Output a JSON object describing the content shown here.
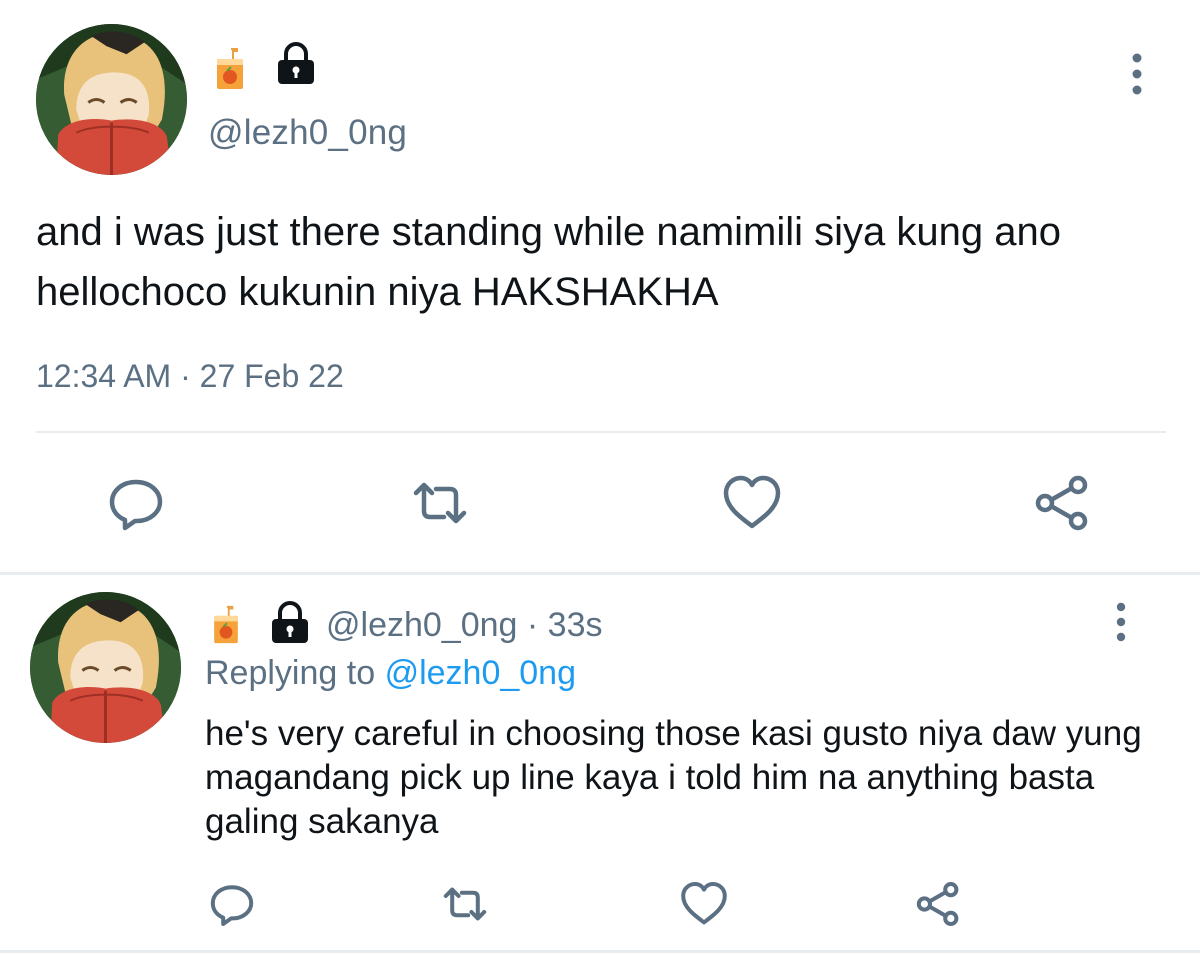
{
  "main_tweet": {
    "handle": "@lezh0_0ng",
    "text": "and i was just there standing while namimili siya kung ano hellochoco kukunin niya HAKSHAKHA",
    "time": "12:34 AM",
    "separator": "·",
    "date": "27 Feb 22",
    "name_icons": [
      "juice-box-icon",
      "lock-icon"
    ]
  },
  "reply_tweet": {
    "handle": "@lezh0_0ng",
    "separator": "·",
    "time_ago": "33s",
    "replying_prefix": "Replying to",
    "replying_to": "@lezh0_0ng",
    "text": "he's very careful in choosing those kasi gusto niya daw yung magandang pick up line kaya i told him na anything basta galing sakanya",
    "name_icons": [
      "juice-box-icon",
      "lock-icon"
    ]
  },
  "actions": [
    "reply-icon",
    "retweet-icon",
    "like-icon",
    "share-icon"
  ],
  "colors": {
    "text": "#0f1419",
    "secondary": "#5b7083",
    "link": "#1d9bf0",
    "divider": "#e6ecf0"
  }
}
